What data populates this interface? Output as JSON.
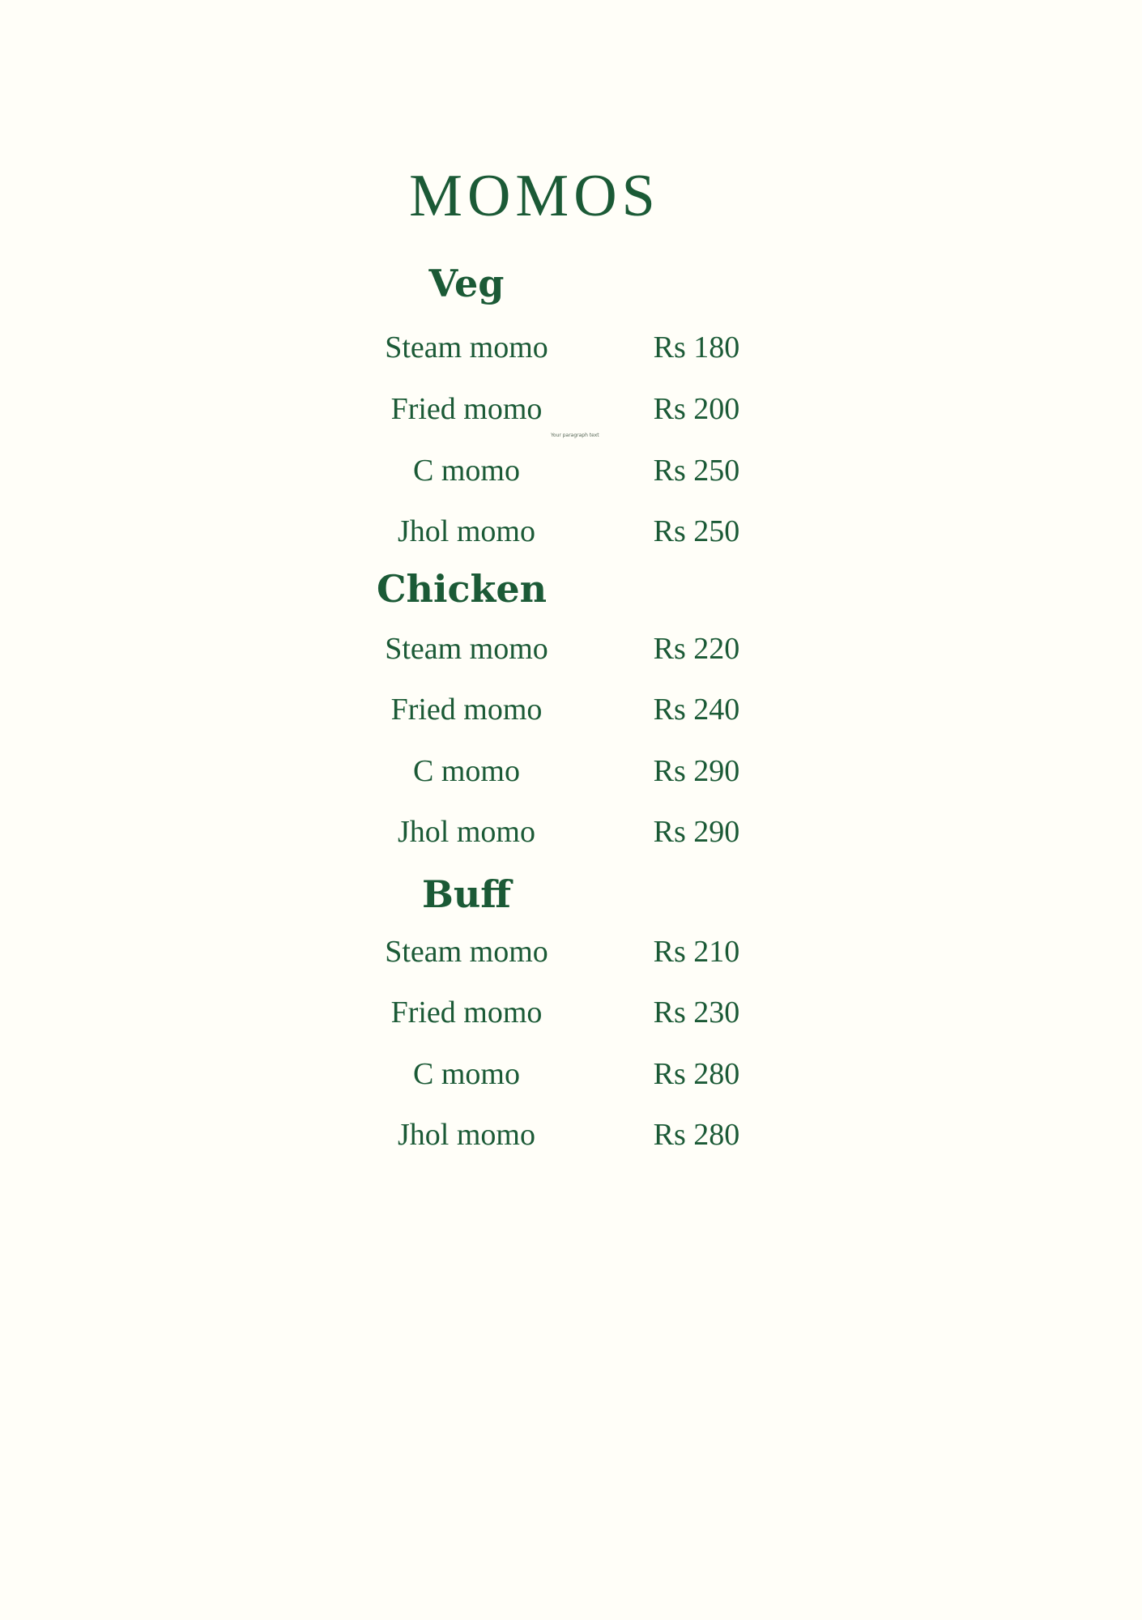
{
  "menu": {
    "title": "MOMOS",
    "stray_text": "Your paragraph text",
    "sections": [
      {
        "heading": "Veg",
        "items": [
          {
            "name": "Steam momo",
            "price": "Rs 180"
          },
          {
            "name": "Fried momo",
            "price": "Rs 200"
          },
          {
            "name": "C momo",
            "price": "Rs 250"
          },
          {
            "name": "Jhol momo",
            "price": "Rs 250"
          }
        ]
      },
      {
        "heading": "Chicken",
        "items": [
          {
            "name": "Steam momo",
            "price": "Rs 220"
          },
          {
            "name": "Fried momo",
            "price": "Rs 240"
          },
          {
            "name": "C momo",
            "price": "Rs 290"
          },
          {
            "name": "Jhol momo",
            "price": "Rs 290"
          }
        ]
      },
      {
        "heading": "Buff",
        "items": [
          {
            "name": "Steam momo",
            "price": "Rs 210"
          },
          {
            "name": "Fried momo",
            "price": "Rs 230"
          },
          {
            "name": "C momo",
            "price": "Rs 280"
          },
          {
            "name": "Jhol momo",
            "price": "Rs 280"
          }
        ]
      }
    ]
  },
  "colors": {
    "background": "#fffef8",
    "text": "#1b5a36"
  }
}
